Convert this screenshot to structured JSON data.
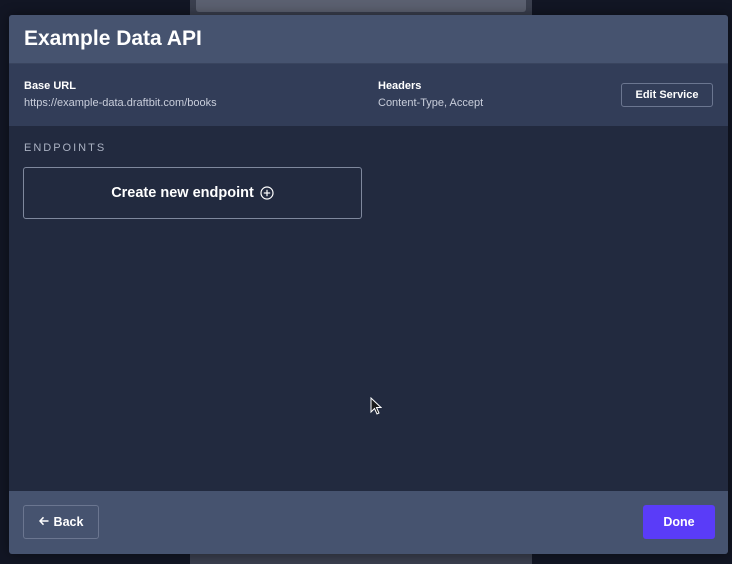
{
  "modal": {
    "title": "Example Data API"
  },
  "info": {
    "base_url_label": "Base URL",
    "base_url_value": "https://example-data.draftbit.com/books",
    "headers_label": "Headers",
    "headers_value": "Content-Type, Accept",
    "edit_service_label": "Edit Service"
  },
  "endpoints": {
    "heading": "ENDPOINTS",
    "create_label": "Create new endpoint",
    "create_icon": "plus-circle-icon"
  },
  "footer": {
    "back_label": "Back",
    "back_icon": "arrow-left-icon",
    "done_label": "Done"
  },
  "colors": {
    "header_bg": "#46536f",
    "info_bg": "#323d58",
    "body_bg": "#222a3f",
    "accent": "#5a3cf8"
  }
}
